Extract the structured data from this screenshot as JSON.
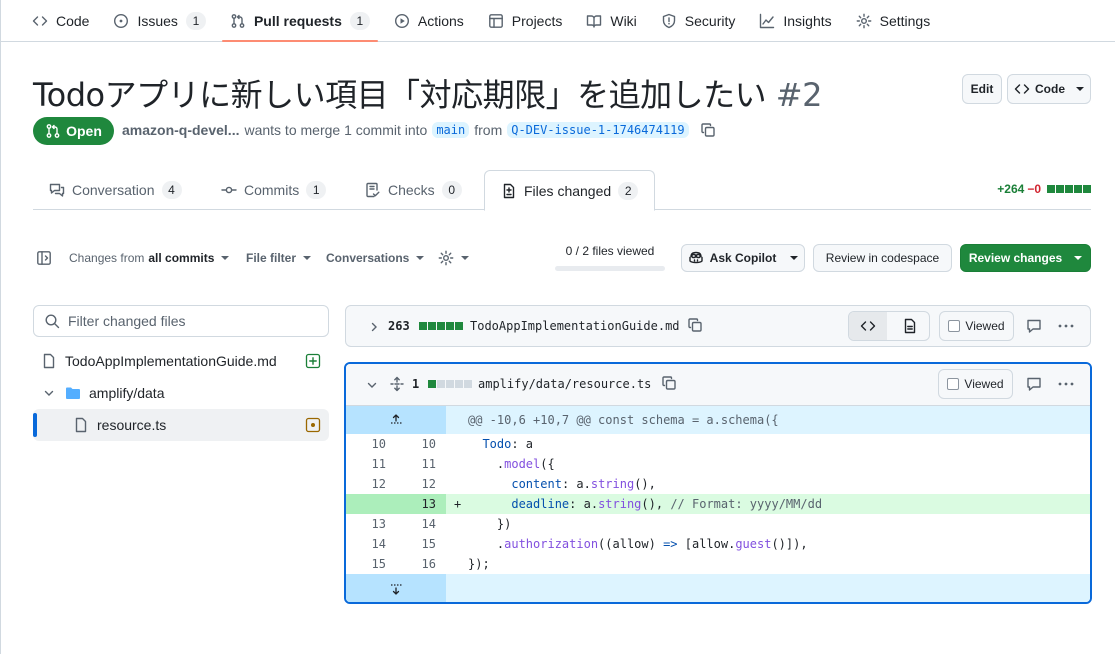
{
  "repo_nav": {
    "items": [
      {
        "label": "Code",
        "icon": "code-icon"
      },
      {
        "label": "Issues",
        "count": "1",
        "icon": "issue-icon"
      },
      {
        "label": "Pull requests",
        "count": "1",
        "icon": "git-pull-request-icon",
        "selected": true
      },
      {
        "label": "Actions",
        "icon": "play-icon"
      },
      {
        "label": "Projects",
        "icon": "table-icon"
      },
      {
        "label": "Wiki",
        "icon": "book-icon"
      },
      {
        "label": "Security",
        "icon": "shield-icon"
      },
      {
        "label": "Insights",
        "icon": "graph-icon"
      },
      {
        "label": "Settings",
        "icon": "gear-icon"
      }
    ]
  },
  "pr": {
    "title": "Todoアプリに新しい項目「対応期限」を追加したい",
    "number": "#2",
    "state": "Open",
    "author": "amazon-q-devel...",
    "merge_text": "wants to merge 1 commit into",
    "base_branch": "main",
    "from_text": "from",
    "head_branch": "Q-DEV-issue-1-1746474119",
    "edit_label": "Edit",
    "code_label": "Code"
  },
  "tabs": [
    {
      "label": "Conversation",
      "count": "4"
    },
    {
      "label": "Commits",
      "count": "1"
    },
    {
      "label": "Checks",
      "count": "0"
    },
    {
      "label": "Files changed",
      "count": "2",
      "selected": true
    }
  ],
  "diffstat": {
    "additions": "+264",
    "deletions": "−0"
  },
  "toolbar": {
    "changes_from": "Changes from",
    "all_commits": "all commits",
    "file_filter": "File filter",
    "conversations": "Conversations",
    "files_viewed": "0 / 2 files viewed",
    "files_viewed_progress": 0,
    "ask_copilot": "Ask Copilot",
    "review_codespace": "Review in codespace",
    "review_changes": "Review changes"
  },
  "file_tree": {
    "filter_placeholder": "Filter changed files",
    "items": [
      {
        "name": "TodoAppImplementationGuide.md",
        "type": "file",
        "status": "added"
      },
      {
        "name": "amplify/data",
        "type": "folder"
      },
      {
        "name": "resource.ts",
        "type": "file",
        "status": "modified",
        "selected": true
      }
    ]
  },
  "files": [
    {
      "changes": "263",
      "path": "TodoAppImplementationGuide.md",
      "viewed_label": "Viewed",
      "collapsed": true
    },
    {
      "changes": "1",
      "path": "amplify/data/resource.ts",
      "viewed_label": "Viewed",
      "collapsed": false
    }
  ],
  "diff": {
    "hunk_header": "@@ -10,6 +10,7 @@ const schema = a.schema({",
    "lines": [
      {
        "old": "10",
        "new": "10",
        "type": "ctx"
      },
      {
        "old": "11",
        "new": "11",
        "type": "ctx"
      },
      {
        "old": "12",
        "new": "12",
        "type": "ctx"
      },
      {
        "old": "",
        "new": "13",
        "type": "add",
        "marker": "+"
      },
      {
        "old": "13",
        "new": "14",
        "type": "ctx"
      },
      {
        "old": "14",
        "new": "15",
        "type": "ctx"
      },
      {
        "old": "15",
        "new": "16",
        "type": "ctx"
      }
    ],
    "code": [
      [
        "  ",
        "Todo",
        ": a"
      ],
      [
        "    .",
        "model",
        "({"
      ],
      [
        "      ",
        "content",
        ": a.",
        "string",
        "(),"
      ],
      [
        "      ",
        "deadline",
        ": a.",
        "string",
        "(), ",
        "// Format: yyyy/MM/dd"
      ],
      [
        "    })"
      ],
      [
        "    .",
        "authorization",
        "((allow) ",
        "=>",
        " [allow.",
        "guest",
        "()]),"
      ],
      [
        "});"
      ]
    ]
  },
  "colors": {
    "accent": "#0969da",
    "green": "#1f883d",
    "add_bg": "#dafbe1",
    "add_num_bg": "#aceebb",
    "hunk_bg": "#ddf4ff",
    "hunk_num_bg": "#b6e3ff",
    "nav_underline": "#fd8c73"
  }
}
